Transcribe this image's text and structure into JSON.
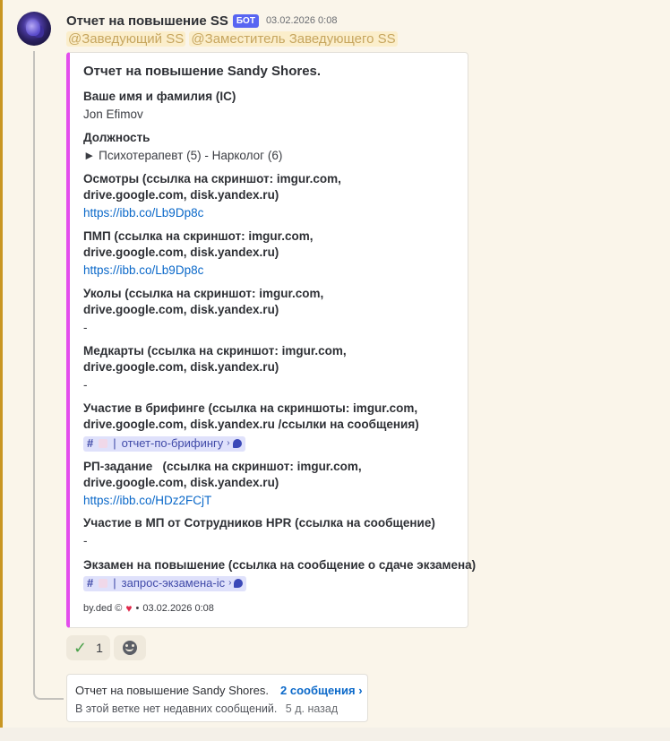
{
  "message": {
    "author": "Отчет на повышение SS",
    "badge": "БОТ",
    "timestamp": "03.02.2026 0:08",
    "mentions": [
      "@Заведующий SS",
      "@Заместитель Заведующего SS"
    ]
  },
  "embed": {
    "accent_color": "#e34ded",
    "title": "Отчет на повышение Sandy Shores.",
    "fields": [
      {
        "name": "Ваше имя и фамилия (IC)",
        "value": "Jon Efimov"
      },
      {
        "name": "Должность",
        "value": "► Психотерапевт (5) - Нарколог (6)"
      },
      {
        "name_lines": [
          "Осмотры (ссылка на скриншот: imgur.com,",
          "drive.google.com, disk.yandex.ru)"
        ],
        "value": "https://ibb.co/Lb9Dp8c"
      },
      {
        "name_lines": [
          "ПМП (ссылка на скриншот: imgur.com,",
          "drive.google.com, disk.yandex.ru)"
        ],
        "value": "https://ibb.co/Lb9Dp8c"
      },
      {
        "name_lines": [
          "Уколы (ссылка на скриншот: imgur.com,",
          "drive.google.com, disk.yandex.ru)"
        ],
        "value": "-"
      },
      {
        "name_lines": [
          "Медкарты (ссылка на скриншот: imgur.com,",
          "drive.google.com, disk.yandex.ru)"
        ],
        "value": "-"
      },
      {
        "name_lines": [
          "Участие в брифинге (ссылка на скриншоты: imgur.com,",
          "drive.google.com, disk.yandex.ru /ссылки на сообщения)"
        ],
        "channel": "отчет-по-брифингу"
      },
      {
        "name_lines": [
          "РП-задание   (ссылка на скриншот: imgur.com,",
          "drive.google.com, disk.yandex.ru)"
        ],
        "value": "https://ibb.co/HDz2FCjT"
      },
      {
        "name": "Участие в МП от Сотрудников HPR (ссылка на сообщение)",
        "value": "-"
      },
      {
        "name": "Экзамен на повышение (ссылка на сообщение о сдаче экзамена)",
        "channel": "запрос-экзамена-ic"
      }
    ],
    "footer": {
      "author": "by.ded ©",
      "separator": "•",
      "timestamp": "03.02.2026 0:08"
    }
  },
  "reactions": [
    {
      "icon": "check-mark-icon",
      "count": "1"
    }
  ],
  "thread": {
    "title": "Отчет на повышение Sandy Shores.",
    "count": "2 сообщения ›",
    "status": "В этой ветке нет недавних сообщений.",
    "age": "5 д. назад"
  },
  "colors": {
    "background": "#faf5ea",
    "badge": "#5865f2",
    "link": "#0a68c9",
    "mention": "#c7a65f"
  }
}
